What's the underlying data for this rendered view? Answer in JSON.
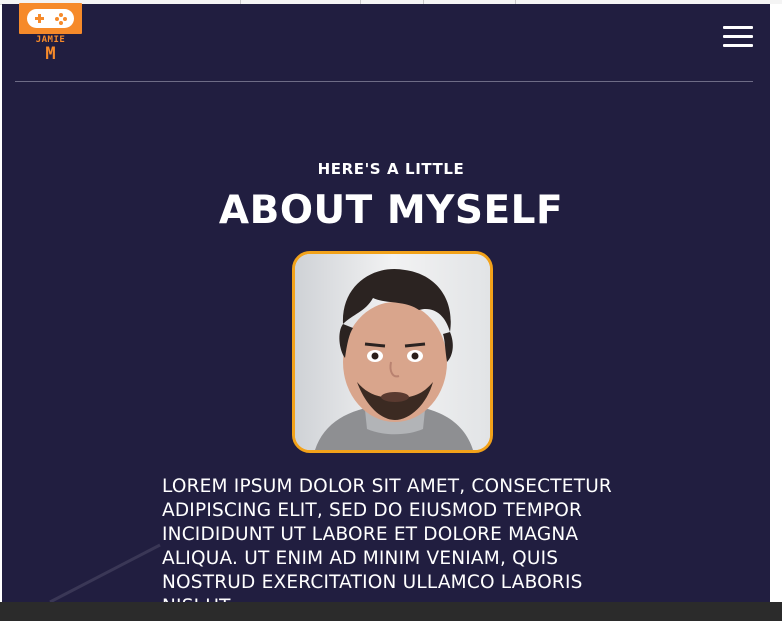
{
  "logo": {
    "line1": "JAMIE",
    "line2": "M",
    "icon": "gamepad-icon"
  },
  "nav": {
    "menu_icon": "hamburger-menu-icon"
  },
  "about": {
    "eyebrow": "HERE'S A LITTLE",
    "heading": "ABOUT MYSELF",
    "photo_subject": "profile-photo",
    "bio": "LOREM IPSUM DOLOR SIT AMET, CONSECTETUR ADIPISCING ELIT, SED DO EIUSMOD TEMPOR INCIDIDUNT UT LABORE ET DOLORE MAGNA ALIQUA. UT ENIM AD MINIM VENIAM, QUIS NOSTRUD EXERCITATION ULLAMCO LABORIS NISI UT"
  },
  "colors": {
    "background": "#211e40",
    "accent": "#f68a2a",
    "photo_border": "#f2a21a",
    "text": "#ffffff"
  }
}
